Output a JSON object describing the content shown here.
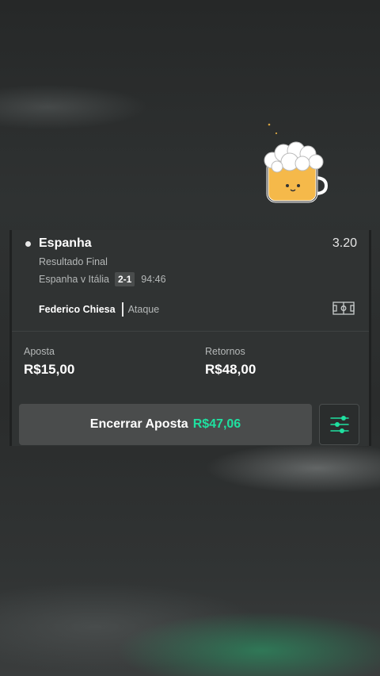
{
  "bet": {
    "selection": "Espanha",
    "odds": "3.20",
    "market": "Resultado Final",
    "event": "Espanha v Itália",
    "score": "2-1",
    "clock": "94:46",
    "player": "Federico Chiesa",
    "position": "Ataque"
  },
  "stake": {
    "label": "Aposta",
    "value": "R$15,00"
  },
  "returns": {
    "label": "Retornos",
    "value": "R$48,00"
  },
  "cashout": {
    "label": "Encerrar Aposta",
    "amount": "R$47,06"
  },
  "colors": {
    "accent_green": "#1fe0a0",
    "card_bg": "#303333",
    "mascot_yellow": "#f5b94a"
  },
  "icons": {
    "pitch": "football-pitch-icon",
    "settings": "sliders-icon",
    "mascot": "beer-mug-sticker"
  }
}
